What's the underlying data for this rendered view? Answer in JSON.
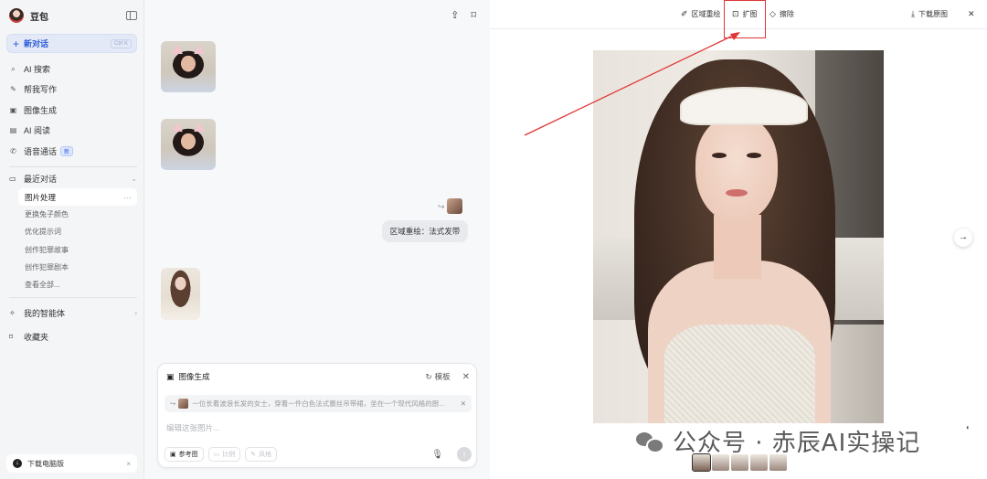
{
  "sidebar": {
    "app_name": "豆包",
    "new_chat": {
      "label": "新对话",
      "shortcut": "Ctrl K"
    },
    "nav": [
      {
        "label": "AI 搜索",
        "icon": "search-icon"
      },
      {
        "label": "帮我写作",
        "icon": "pen-icon"
      },
      {
        "label": "图像生成",
        "icon": "image-icon"
      },
      {
        "label": "AI 阅读",
        "icon": "book-icon"
      },
      {
        "label": "语音通话",
        "icon": "phone-icon",
        "badge": "新"
      }
    ],
    "recent": {
      "title": "最近对话",
      "items": [
        "图片处理",
        "更换兔子颜色",
        "优化提示词",
        "创作犯罪故事",
        "创作犯罪剧本",
        "查看全部..."
      ]
    },
    "agents": "我的智能体",
    "favorites": "收藏夹",
    "download": "下载电脑版"
  },
  "chat": {
    "user_bubble": "区域重绘：法式发带",
    "composer": {
      "mode": "图像生成",
      "template": "模板",
      "reference_text": "一位长着波浪长发的女士，穿着一件白色法式蕾丝吊带裙，坐在一个现代风格的厨...",
      "placeholder": "编辑这张图片...",
      "chips": [
        "参考图",
        "比例",
        "风格"
      ]
    }
  },
  "viewer": {
    "tools": [
      "区域重绘",
      "扩图",
      "擦除"
    ],
    "download": "下载原图",
    "watermark": "公众号 · 赤辰AI实操记"
  },
  "colors": {
    "accent": "#2b5bd7",
    "highlight": "#e03535"
  }
}
